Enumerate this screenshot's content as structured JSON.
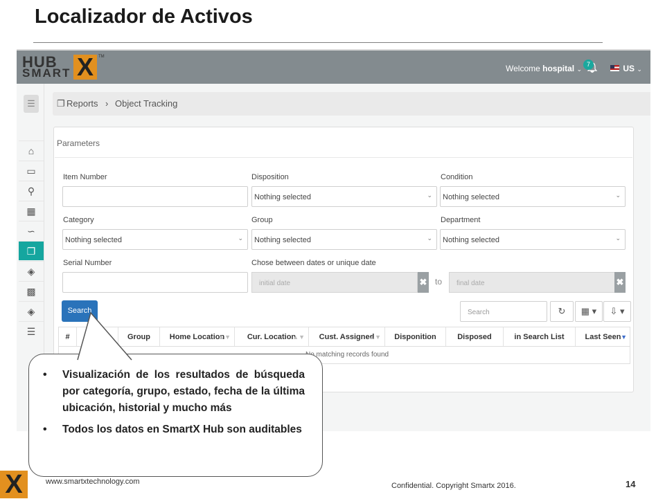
{
  "slide": {
    "title": "Localizador de Activos",
    "footer_url": "www.smartxtechnology.com",
    "footer_confidential": "Confidential. Copyright Smartx 2016.",
    "page_number": "14"
  },
  "app": {
    "logo_line1": "HUB",
    "logo_line2": "SMART",
    "logo_x": "X",
    "logo_tm": "TM",
    "welcome_prefix": "Welcome",
    "welcome_user": "hospital",
    "notification_count": "7",
    "language": "US"
  },
  "breadcrumb": {
    "reports": "Reports",
    "separator": "›",
    "current": "Object Tracking"
  },
  "parameters": {
    "title": "Parameters",
    "item_number_label": "Item Number",
    "disposition_label": "Disposition",
    "disposition_value": "Nothing selected",
    "condition_label": "Condition",
    "condition_value": "Nothing selected",
    "category_label": "Category",
    "category_value": "Nothing selected",
    "group_label": "Group",
    "group_value": "Nothing selected",
    "department_label": "Department",
    "department_value": "Nothing selected",
    "serial_number_label": "Serial Number",
    "date_label": "Chose between dates or unique date",
    "initial_date_placeholder": "initial date",
    "to_label": "to",
    "final_date_placeholder": "final date",
    "search_button": "Search"
  },
  "table_toolbar": {
    "search_placeholder": "Search"
  },
  "table": {
    "columns": [
      "#",
      "Group",
      "Home Location",
      "Cur. Location",
      "Cust. Assigned",
      "Disponition",
      "Disposed",
      "in Search List",
      "Last Seen"
    ],
    "empty_message": "No matching records found"
  },
  "callout": {
    "bullets": [
      "Visualización de los resultados de búsqueda por categoría, grupo, estado, fecha de la última ubicación, historial y mucho más",
      "Todos los datos en SmartX Hub son auditables"
    ]
  },
  "colors": {
    "topbar": "#838b8f",
    "accent_teal": "#15a69f",
    "search_blue": "#2a73ba",
    "brand_orange": "#e2901f"
  },
  "icons": [
    "home-icon",
    "monitor-icon",
    "paint-roller-icon",
    "map-icon",
    "rss-icon",
    "reports-icon",
    "layers-icon",
    "bar-chart-icon",
    "layers-icon-2",
    "list-icon"
  ]
}
